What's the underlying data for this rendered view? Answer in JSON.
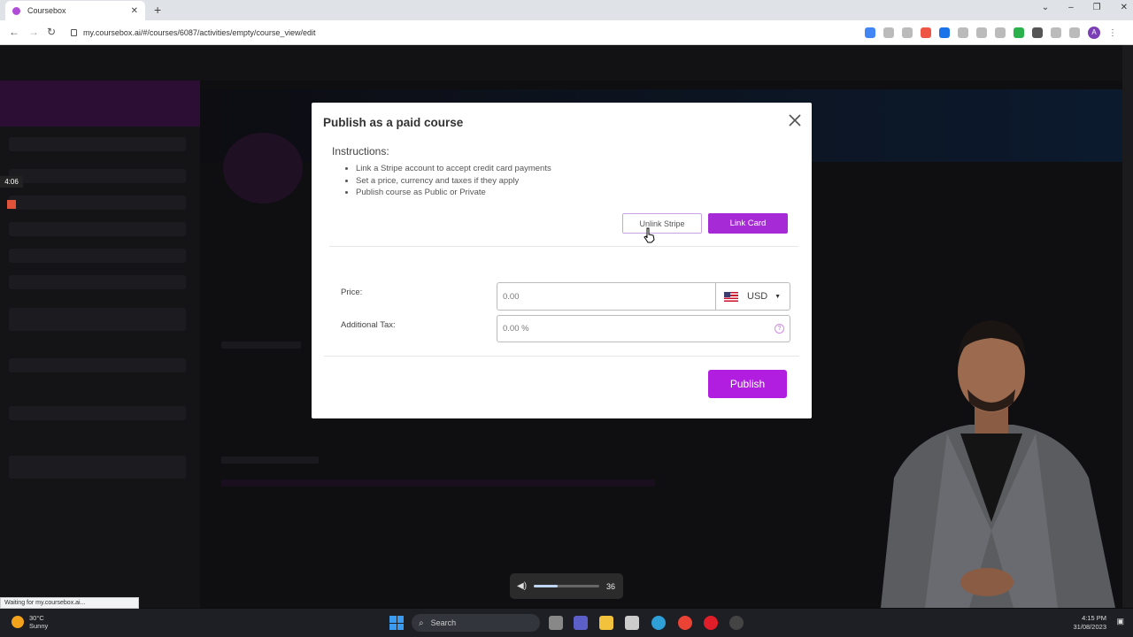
{
  "browser": {
    "tab_title": "Coursebox",
    "new_tab_icon": "plus-icon",
    "url": "my.coursebox.ai/#/courses/6087/activities/empty/course_view/edit",
    "profile_initial": "A",
    "status_text": "Waiting for my.coursebox.ai..."
  },
  "app": {
    "recording_timer": "4:06"
  },
  "modal": {
    "title": "Publish as a paid course",
    "instructions_title": "Instructions:",
    "instructions": [
      "Link a Stripe account to accept credit card payments",
      "Set a price, currency and taxes if they apply",
      "Publish course as Public or Private"
    ],
    "unlink_stripe_label": "Unlink Stripe",
    "link_card_label": "Link Card",
    "price_label": "Price:",
    "price_value": "0.00",
    "currency_value": "USD",
    "tax_label": "Additional Tax:",
    "tax_value": "0.00 %",
    "help_symbol": "?",
    "publish_label": "Publish"
  },
  "volume": {
    "level_text": "36",
    "level_fraction": 0.36
  },
  "taskbar": {
    "weather_temp": "30°C",
    "weather_desc": "Sunny",
    "search_label": "Search",
    "time": "4:15 PM",
    "date": "31/08/2023"
  },
  "colors": {
    "accent_purple": "#b11ee0",
    "link_card_purple": "#a62ad6"
  }
}
